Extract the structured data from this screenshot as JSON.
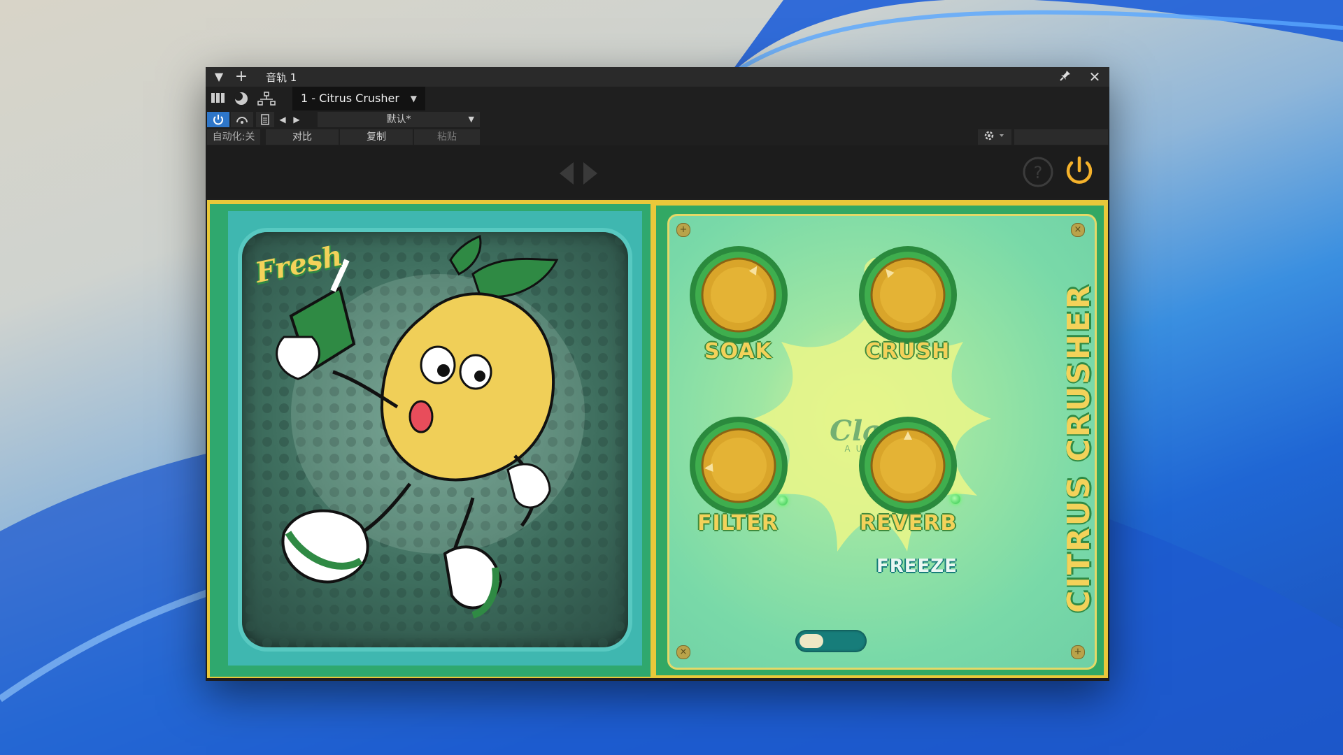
{
  "window": {
    "track_title": "音轨 1",
    "preset_name": "1 - Citrus Crusher",
    "preset_default": "默认*",
    "automation": "自动化:关",
    "compare": "对比",
    "copy": "复制",
    "paste": "粘贴"
  },
  "plugin": {
    "badge": "Fresh",
    "brand": "Clark",
    "brand_sub": "AUDIO",
    "side_title": "CITRUS CRUSHER",
    "knobs": [
      {
        "label": "SOAK",
        "value": 0.62
      },
      {
        "label": "CRUSH",
        "value": 0.35
      },
      {
        "label": "FILTER",
        "value": 0.15
      },
      {
        "label": "REVERB",
        "value": 0.5
      }
    ],
    "freeze_label": "FREEZE",
    "freeze_on": false
  },
  "colors": {
    "knob_gold": "#d9a52a",
    "label_yellow": "#f3d25a",
    "label_outline": "#3e8a3d",
    "power_orange": "#f5b22b",
    "bypass_blue": "#2e76c9"
  },
  "icons": [
    "chevron-down-icon",
    "plus-icon",
    "pin-icon",
    "close-icon",
    "columns-icon",
    "moon-icon",
    "routing-icon",
    "power-icon",
    "link-icon",
    "preset-icon",
    "prev-arrow-icon",
    "next-arrow-icon",
    "gear-icon",
    "help-icon"
  ]
}
